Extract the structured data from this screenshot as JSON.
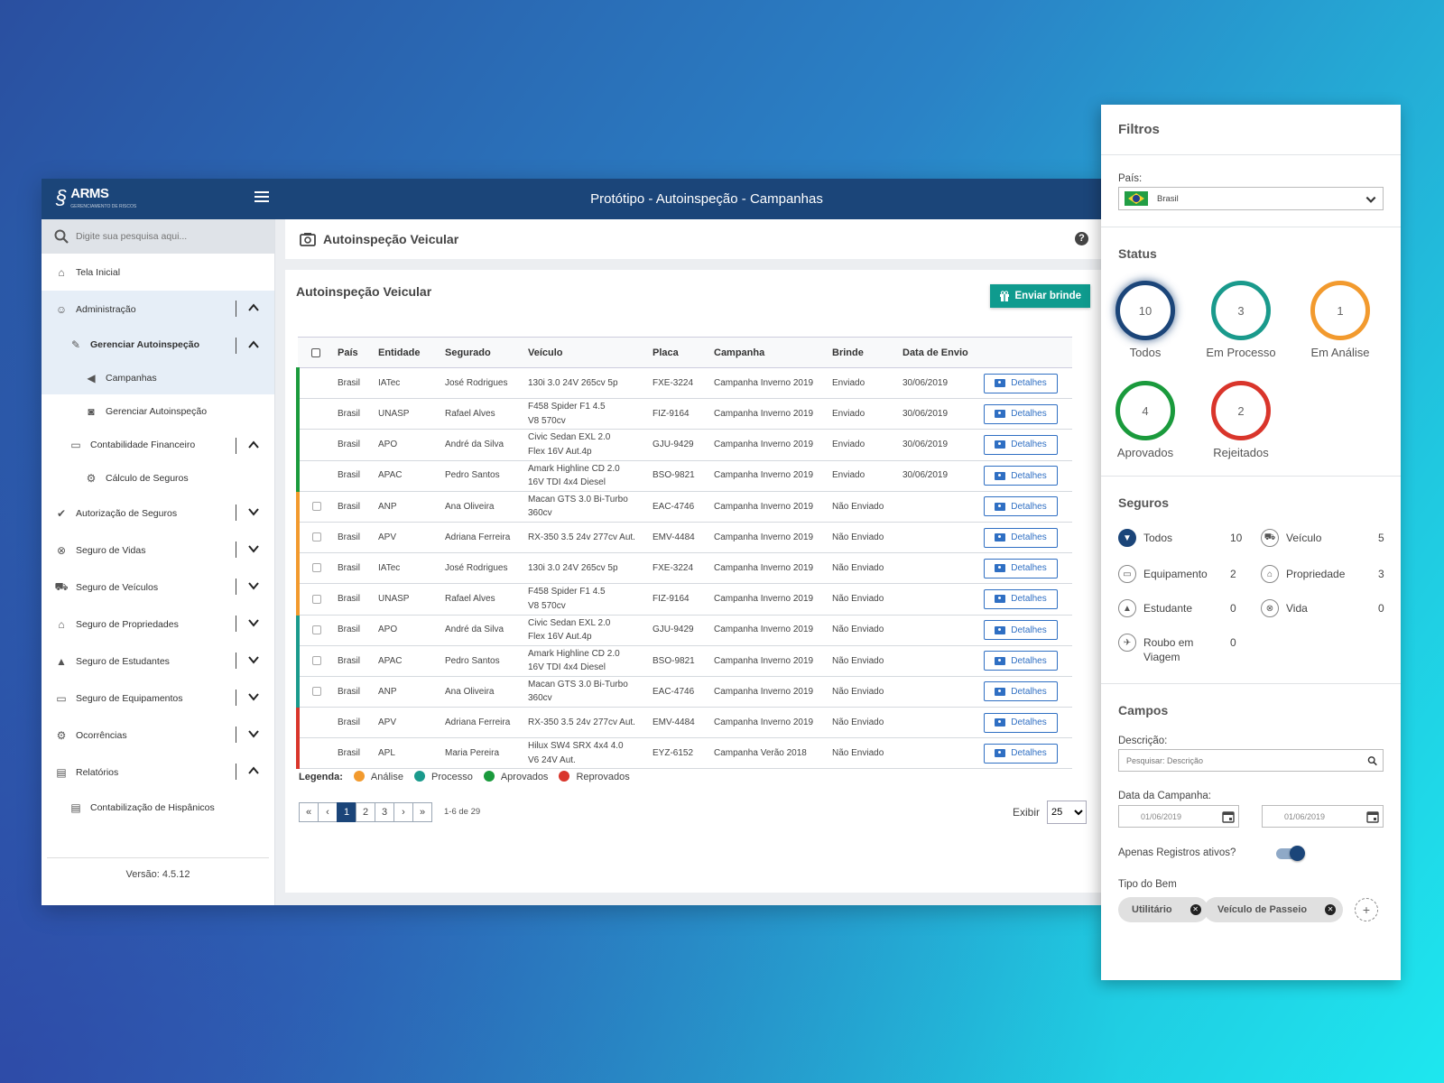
{
  "app": {
    "title": "Protótipo - Autoinspeção - Campanhas",
    "logo_text": "ARMS",
    "logo_sub": "GERENCIAMENTO DE RISCOS"
  },
  "sidebar": {
    "search_placeholder": "Digite sua pesquisa aqui...",
    "items": [
      {
        "label": "Tela Inicial",
        "icon": "home-icon"
      },
      {
        "label": "Administração",
        "icon": "user-icon",
        "chevron": "up"
      },
      {
        "label": "Gerenciar Autoinspeção",
        "icon": "edit-icon",
        "chevron": "up"
      },
      {
        "label": "Campanhas",
        "icon": "megaphone-icon"
      },
      {
        "label": "Gerenciar Autoinspeção",
        "icon": "camera-icon"
      },
      {
        "label": "Contabilidade Financeiro",
        "icon": "card-icon",
        "chevron": "up"
      },
      {
        "label": "Cálculo de Seguros",
        "icon": "cogs-icon"
      },
      {
        "label": "Autorização de Seguros",
        "icon": "check-circle-icon",
        "chevron": "down"
      },
      {
        "label": "Seguro de Vidas",
        "icon": "lifebuoy-icon",
        "chevron": "down"
      },
      {
        "label": "Seguro de Veículos",
        "icon": "car-icon",
        "chevron": "down"
      },
      {
        "label": "Seguro de Propriedades",
        "icon": "home-icon",
        "chevron": "down"
      },
      {
        "label": "Seguro de Estudantes",
        "icon": "graduation-cap-icon",
        "chevron": "down"
      },
      {
        "label": "Seguro de Equipamentos",
        "icon": "laptop-icon",
        "chevron": "down"
      },
      {
        "label": "Ocorrências",
        "icon": "gear-icon",
        "chevron": "down"
      },
      {
        "label": "Relatórios",
        "icon": "pdf-file-icon",
        "chevron": "up"
      },
      {
        "label": "Contabilização de Hispânicos",
        "icon": "pdf-file-icon"
      }
    ],
    "version": "Versão: 4.5.12"
  },
  "page": {
    "header": "Autoinspeção Veicular",
    "card_title": "Autoinspeção Veicular",
    "send_button": "Enviar brinde"
  },
  "table": {
    "columns": [
      "País",
      "Entidade",
      "Segurado",
      "Veículo",
      "Placa",
      "Campanha",
      "Brinde",
      "Data de Envio"
    ],
    "detail_label": "Detalhes",
    "rows": [
      {
        "status": "aprovado",
        "checkbox": false,
        "pais": "Brasil",
        "entidade": "IATec",
        "segurado": "José Rodrigues",
        "veiculo": "130i 3.0 24V 265cv 5p",
        "placa": "FXE-3224",
        "campanha": "Campanha Inverno 2019",
        "brinde": "Enviado",
        "data": "30/06/2019"
      },
      {
        "status": "aprovado",
        "checkbox": false,
        "pais": "Brasil",
        "entidade": "UNASP",
        "segurado": "Rafael Alves",
        "veiculo": "F458 Spider F1 4.5\nV8 570cv",
        "placa": "FIZ-9164",
        "campanha": "Campanha Inverno 2019",
        "brinde": "Enviado",
        "data": "30/06/2019"
      },
      {
        "status": "aprovado",
        "checkbox": false,
        "pais": "Brasil",
        "entidade": "APO",
        "segurado": "André da Silva",
        "veiculo": "Civic Sedan EXL 2.0\nFlex 16V Aut.4p",
        "placa": "GJU-9429",
        "campanha": "Campanha Inverno 2019",
        "brinde": "Enviado",
        "data": "30/06/2019"
      },
      {
        "status": "aprovado",
        "checkbox": false,
        "pais": "Brasil",
        "entidade": "APAC",
        "segurado": "Pedro Santos",
        "veiculo": "Amark Highline CD 2.0\n16V TDI 4x4 Diesel",
        "placa": "BSO-9821",
        "campanha": "Campanha Inverno 2019",
        "brinde": "Enviado",
        "data": "30/06/2019"
      },
      {
        "status": "analise",
        "checkbox": true,
        "pais": "Brasil",
        "entidade": "ANP",
        "segurado": "Ana Oliveira",
        "veiculo": "Macan GTS 3.0 Bi-Turbo\n360cv",
        "placa": "EAC-4746",
        "campanha": "Campanha Inverno 2019",
        "brinde": "Não Enviado",
        "data": ""
      },
      {
        "status": "analise",
        "checkbox": true,
        "pais": "Brasil",
        "entidade": "APV",
        "segurado": "Adriana Ferreira",
        "veiculo": "RX-350 3.5 24v 277cv Aut.",
        "placa": "EMV-4484",
        "campanha": "Campanha Inverno 2019",
        "brinde": "Não Enviado",
        "data": ""
      },
      {
        "status": "analise",
        "checkbox": true,
        "pais": "Brasil",
        "entidade": "IATec",
        "segurado": "José Rodrigues",
        "veiculo": "130i 3.0 24V 265cv 5p",
        "placa": "FXE-3224",
        "campanha": "Campanha Inverno 2019",
        "brinde": "Não Enviado",
        "data": ""
      },
      {
        "status": "analise",
        "checkbox": true,
        "pais": "Brasil",
        "entidade": "UNASP",
        "segurado": "Rafael Alves",
        "veiculo": "F458 Spider F1 4.5\nV8 570cv",
        "placa": "FIZ-9164",
        "campanha": "Campanha Inverno 2019",
        "brinde": "Não Enviado",
        "data": ""
      },
      {
        "status": "processo",
        "checkbox": true,
        "pais": "Brasil",
        "entidade": "APO",
        "segurado": "André da Silva",
        "veiculo": "Civic Sedan EXL 2.0\nFlex 16V Aut.4p",
        "placa": "GJU-9429",
        "campanha": "Campanha Inverno 2019",
        "brinde": "Não Enviado",
        "data": ""
      },
      {
        "status": "processo",
        "checkbox": true,
        "pais": "Brasil",
        "entidade": "APAC",
        "segurado": "Pedro Santos",
        "veiculo": "Amark Highline CD 2.0\n16V TDI 4x4 Diesel",
        "placa": "BSO-9821",
        "campanha": "Campanha Inverno 2019",
        "brinde": "Não Enviado",
        "data": ""
      },
      {
        "status": "processo",
        "checkbox": true,
        "pais": "Brasil",
        "entidade": "ANP",
        "segurado": "Ana Oliveira",
        "veiculo": "Macan GTS 3.0 Bi-Turbo\n360cv",
        "placa": "EAC-4746",
        "campanha": "Campanha Inverno 2019",
        "brinde": "Não Enviado",
        "data": ""
      },
      {
        "status": "reprovado",
        "checkbox": false,
        "pais": "Brasil",
        "entidade": "APV",
        "segurado": "Adriana Ferreira",
        "veiculo": "RX-350 3.5 24v 277cv Aut.",
        "placa": "EMV-4484",
        "campanha": "Campanha Inverno 2019",
        "brinde": "Não Enviado",
        "data": ""
      },
      {
        "status": "reprovado",
        "checkbox": false,
        "pais": "Brasil",
        "entidade": "APL",
        "segurado": "Maria Pereira",
        "veiculo": "Hilux SW4 SRX 4x4 4.0\nV6 24V Aut.",
        "placa": "EYZ-6152",
        "campanha": "Campanha Verão 2018",
        "brinde": "Não Enviado",
        "data": ""
      }
    ]
  },
  "legend": {
    "title": "Legenda:",
    "items": [
      {
        "label": "Análise",
        "color": "#f29a2e"
      },
      {
        "label": "Processo",
        "color": "#1a9a8c"
      },
      {
        "label": "Aprovados",
        "color": "#1a9a3c"
      },
      {
        "label": "Reprovados",
        "color": "#d9352b"
      }
    ]
  },
  "status_colors": {
    "analise": "#f29a2e",
    "processo": "#1a9a8c",
    "aprovado": "#1a9a3c",
    "reprovado": "#d9352b"
  },
  "pagination": {
    "first": "«",
    "prev": "‹",
    "pages": [
      "1",
      "2",
      "3"
    ],
    "current": "1",
    "next": "›",
    "last": "»",
    "count_text": "1-6 de 29",
    "show_label": "Exibir",
    "page_size": "25"
  },
  "filters": {
    "title": "Filtros",
    "country_label": "País:",
    "country_value": "Brasil",
    "status_title": "Status",
    "status": [
      {
        "label": "Todos",
        "count": "10",
        "color": "#1b4579",
        "selected": true
      },
      {
        "label": "Em Processo",
        "count": "3",
        "color": "#1a9a8c"
      },
      {
        "label": "Em Análise",
        "count": "1",
        "color": "#f29a2e"
      },
      {
        "label": "Aprovados",
        "count": "4",
        "color": "#1a9a3c"
      },
      {
        "label": "Rejeitados",
        "count": "2",
        "color": "#d9352b"
      }
    ],
    "seguros_title": "Seguros",
    "seguros": [
      {
        "label": "Todos",
        "count": "10",
        "icon": "filter-icon"
      },
      {
        "label": "Veículo",
        "count": "5",
        "icon": "car-icon"
      },
      {
        "label": "Equipamento",
        "count": "2",
        "icon": "laptop-icon"
      },
      {
        "label": "Propriedade",
        "count": "3",
        "icon": "home-icon"
      },
      {
        "label": "Estudante",
        "count": "0",
        "icon": "graduation-cap-icon"
      },
      {
        "label": "Vida",
        "count": "0",
        "icon": "lifebuoy-icon"
      },
      {
        "label": "Roubo em Viagem",
        "count": "0",
        "icon": "plane-icon"
      }
    ],
    "campos_title": "Campos",
    "descricao_label": "Descrição:",
    "descricao_placeholder": "Pesquisar: Descrição",
    "data_label": "Data da Campanha:",
    "date_from": "01/06/2019",
    "date_to": "01/06/2019",
    "ativos_label": "Apenas Registros ativos?",
    "ativos_on": true,
    "tipo_label": "Tipo do Bem",
    "chips": [
      "Utilitário",
      "Veículo de Passeio"
    ]
  }
}
